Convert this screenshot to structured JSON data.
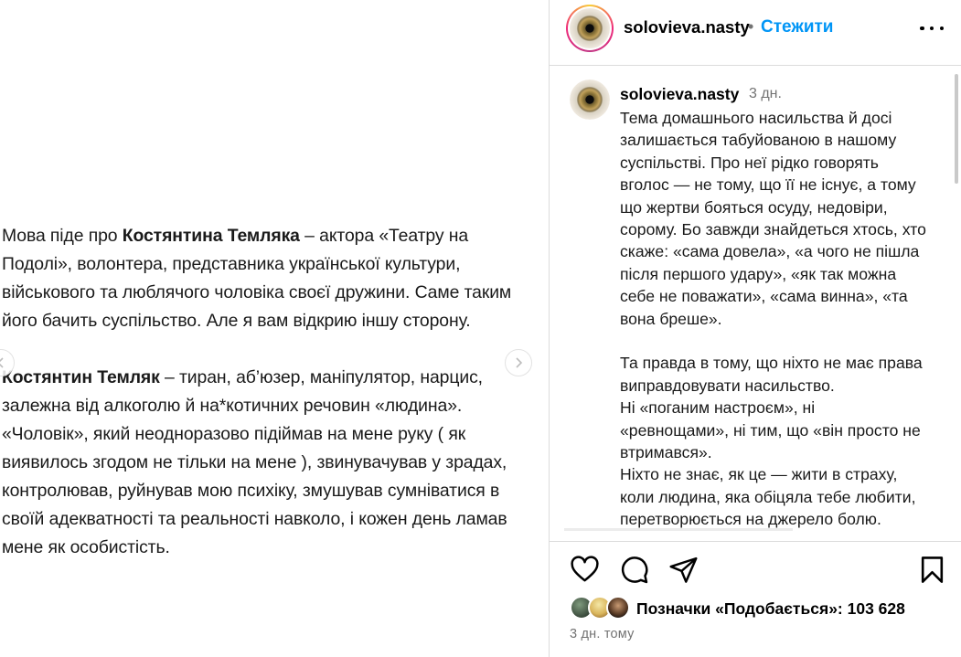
{
  "post": {
    "paragraphs": [
      [
        {
          "t": "Мова піде про ",
          "b": false
        },
        {
          "t": "Костянтина Темляка",
          "b": true
        },
        {
          "t": " – актора «Театру на Подолі», волонтера, представника української культури, військового та люблячого чоловіка своєї дружини. Саме таким його бачить суспільство. Але я вам відкрию іншу сторону.",
          "b": false
        }
      ],
      [
        {
          "t": "Костянтин Темляк",
          "b": true
        },
        {
          "t": " – тиран, аб’юзер, маніпулятор, нарцис, залежна від алкоголю й на*котичних речовин «людина». «Чоловік», який неодноразово підіймав на мене руку ( як виявилось згодом не тільки на мене ), звинувачував у зрадах, контролював, руйнував мою психіку, змушував сумніватися в своїй адекватності та реальності навколо, і кожен день ламав мене як особистість.",
          "b": false
        }
      ]
    ]
  },
  "header": {
    "username": "solovieva.nasty",
    "separator": "•",
    "follow_label": "Стежити"
  },
  "caption": {
    "username": "solovieva.nasty",
    "time": "3 дн.",
    "lines": [
      "Тема домашнього насильства й досі",
      "залишається табуйованою в нашому",
      "суспільстві. Про неї рідко говорять",
      "вголос — не тому, що її не існує, а тому",
      "що жертви бояться осуду, недовіри,",
      "сорому. Бо завжди знайдеться хтось, хто",
      "скаже: «сама довела», «а чого не пішла",
      "після першого удару», «як так можна",
      "себе не поважати», «сама винна», «та",
      "вона бреше».",
      "",
      "Та правда в тому, що ніхто не має права",
      "виправдовувати насильство.",
      "Ні «поганим настроєм», ні",
      "«ревнощами», ні тим, що «він просто не",
      "втримався».",
      "Ніхто не знає, як це — жити в страху,",
      "коли людина, яка обіцяла тебе любити,",
      "перетворюється на джерело болю."
    ]
  },
  "actions": {
    "icons": [
      "heart-icon",
      "comment-icon",
      "share-icon",
      "bookmark-icon"
    ]
  },
  "likes": {
    "text": "Позначки «Подобається»: 103 628"
  },
  "post_date": "3 дн. тому",
  "colors": {
    "link_blue": "#0095f6",
    "secondary_text": "#737373",
    "divider": "#dbdbdb"
  }
}
